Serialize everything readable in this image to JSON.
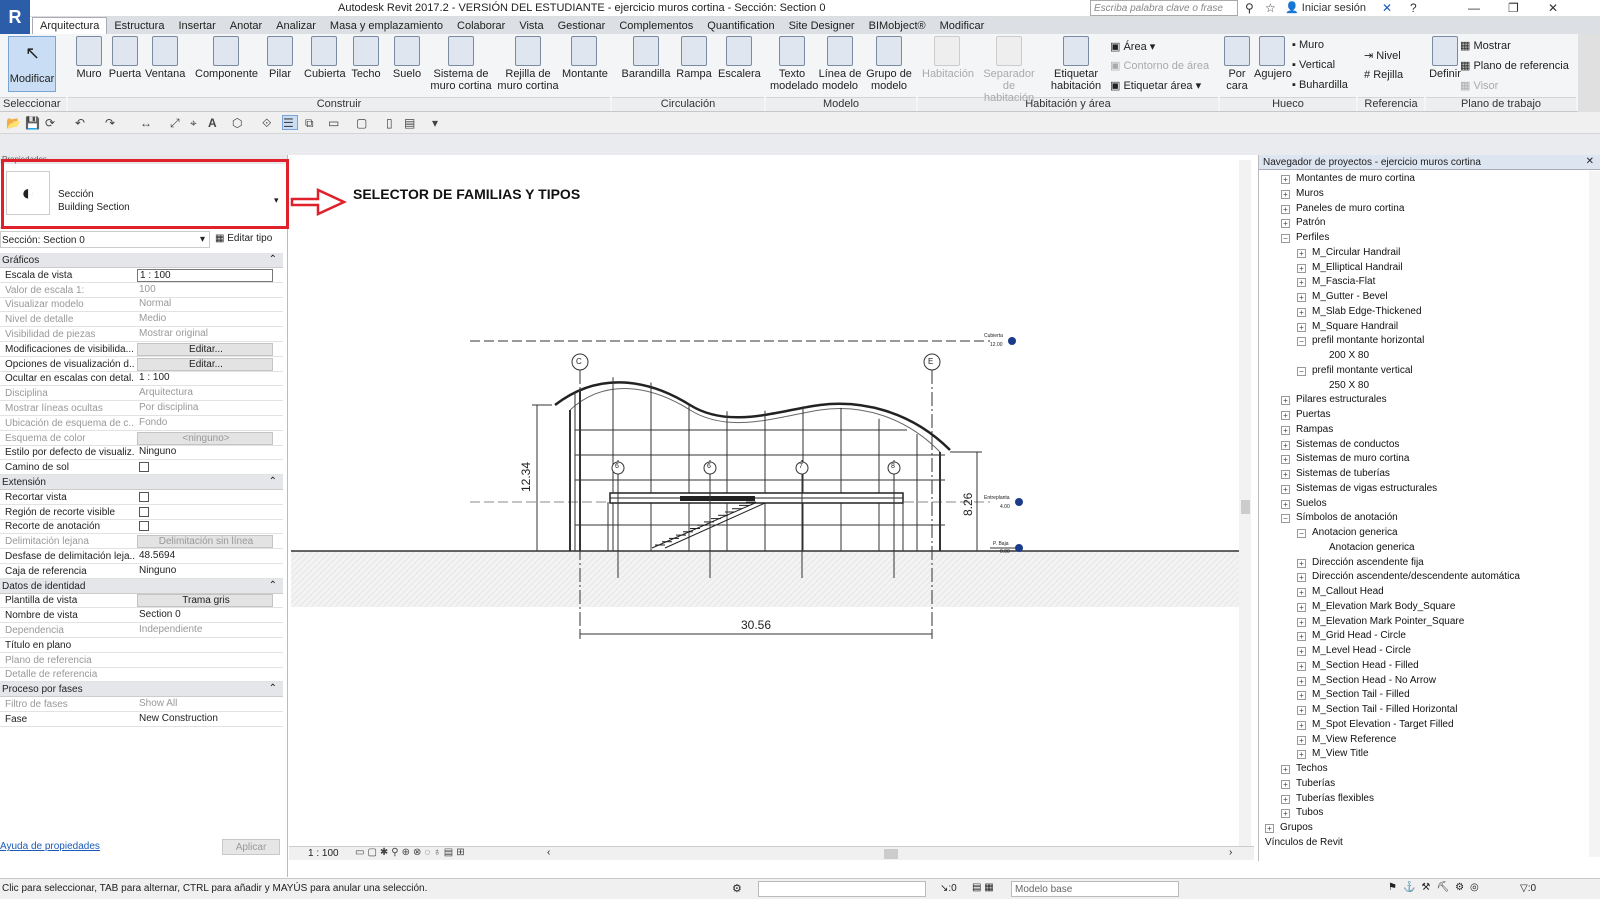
{
  "title_bar": {
    "window_title": "Autodesk Revit 2017.2 - VERSIÓN DEL ESTUDIANTE -    ejercicio muros cortina - Sección: Section 0",
    "search_placeholder": "Escriba palabra clave o frase",
    "sign_in": "Iniciar sesión"
  },
  "tabs": [
    "Arquitectura",
    "Estructura",
    "Insertar",
    "Anotar",
    "Analizar",
    "Masa y emplazamiento",
    "Colaborar",
    "Vista",
    "Gestionar",
    "Complementos",
    "Quantification",
    "Site Designer",
    "BIMobject®",
    "Modificar"
  ],
  "ribbon": {
    "modify": "Modificar",
    "select": "Seleccionar",
    "build": {
      "label": "Construir",
      "buttons": [
        "Muro",
        "Puerta",
        "Ventana",
        "Componente",
        "Pilar",
        "Cubierta",
        "Techo",
        "Suelo",
        "Sistema de muro cortina",
        "Rejilla de muro cortina",
        "Montante"
      ]
    },
    "circulation": {
      "label": "Circulación",
      "buttons": [
        "Barandilla",
        "Rampa",
        "Escalera"
      ]
    },
    "model": {
      "label": "Modelo",
      "buttons": [
        "Texto modelado",
        "Línea de modelo",
        "Grupo de modelo"
      ]
    },
    "room": {
      "label": "Habitación y área",
      "buttons": [
        "Habitación",
        "Separador de habitación",
        "Etiquetar habitación"
      ],
      "small": [
        "Área",
        "Contorno de área",
        "Etiquetar área"
      ]
    },
    "opening": {
      "label": "Hueco",
      "buttons": [
        "Por cara",
        "Agujero"
      ],
      "small": [
        "Muro",
        "Vertical",
        "Buhardilla"
      ]
    },
    "datum": {
      "label": "Referencia",
      "small": [
        "Nivel",
        "Rejilla"
      ]
    },
    "workplane": {
      "label": "Plano de trabajo",
      "buttons": [
        "Definir"
      ],
      "small": [
        "Mostrar",
        "Plano de referencia",
        "Visor"
      ]
    }
  },
  "properties": {
    "header": "Propiedades",
    "family": "Sección",
    "type": "Building Section",
    "instance": "Sección: Section 0",
    "edit_type": "Editar tipo",
    "sections": {
      "graphics": "Gráficos",
      "extents": "Extensión",
      "identity": "Datos de identidad",
      "phasing": "Proceso por fases"
    },
    "graphics_rows": [
      {
        "k": "Escala de vista",
        "v": "1 : 100"
      },
      {
        "k": "Valor de escala    1:",
        "v": "100"
      },
      {
        "k": "Visualizar modelo",
        "v": "Normal"
      },
      {
        "k": "Nivel de detalle",
        "v": "Medio"
      },
      {
        "k": "Visibilidad de piezas",
        "v": "Mostrar original"
      },
      {
        "k": "Modificaciones de visibilida...",
        "v": "Editar..."
      },
      {
        "k": "Opciones de visualización d...",
        "v": "Editar..."
      },
      {
        "k": "Ocultar en escalas con detal...",
        "v": "1 : 100"
      },
      {
        "k": "Disciplina",
        "v": "Arquitectura"
      },
      {
        "k": "Mostrar líneas ocultas",
        "v": "Por disciplina"
      },
      {
        "k": "Ubicación de esquema de c...",
        "v": "Fondo"
      },
      {
        "k": "Esquema de color",
        "v": "<ninguno>"
      },
      {
        "k": "Estilo por defecto de visualiz...",
        "v": "Ninguno"
      },
      {
        "k": "Camino de sol",
        "v": ""
      }
    ],
    "extent_rows": [
      {
        "k": "Recortar vista",
        "v": ""
      },
      {
        "k": "Región de recorte visible",
        "v": ""
      },
      {
        "k": "Recorte de anotación",
        "v": ""
      },
      {
        "k": "Delimitación lejana",
        "v": "Delimitación sin línea"
      },
      {
        "k": "Desfase de delimitación leja...",
        "v": "48.5694"
      },
      {
        "k": "Caja de referencia",
        "v": "Ninguno"
      }
    ],
    "identity_rows": [
      {
        "k": "Plantilla de vista",
        "v": "Trama gris"
      },
      {
        "k": "Nombre de vista",
        "v": "Section 0"
      },
      {
        "k": "Dependencia",
        "v": "Independiente"
      },
      {
        "k": "Título en plano",
        "v": ""
      },
      {
        "k": "Plano de referencia",
        "v": ""
      },
      {
        "k": "Detalle de referencia",
        "v": ""
      }
    ],
    "phasing_rows": [
      {
        "k": "Filtro de fases",
        "v": "Show All"
      },
      {
        "k": "Fase",
        "v": "New Construction"
      }
    ],
    "help": "Ayuda de propiedades",
    "apply": "Aplicar"
  },
  "view": {
    "callout": "SELECTOR DE FAMILIAS Y TIPOS",
    "grid_c": "C",
    "grid_e": "E",
    "marks": [
      "6",
      "6",
      "7",
      "8"
    ],
    "dim_height_left": "12.34",
    "dim_height_right": "8.26",
    "dim_width": "30.56",
    "level_top": "Cubierta",
    "level_top_value": "12.00",
    "level_mid": "Entreplanta",
    "level_mid_value": "4.00",
    "level_base": "P. Baja",
    "level_base_value": "0.00",
    "scale": "1 : 100"
  },
  "navigator": {
    "title": "Navegador de proyectos - ejercicio muros cortina",
    "items": [
      {
        "label": "Montantes de muro cortina",
        "level": 1,
        "sign": "+"
      },
      {
        "label": "Muros",
        "level": 1,
        "sign": "+"
      },
      {
        "label": "Paneles de muro cortina",
        "level": 1,
        "sign": "+"
      },
      {
        "label": "Patrón",
        "level": 1,
        "sign": "+"
      },
      {
        "label": "Perfiles",
        "level": 1,
        "sign": "−"
      },
      {
        "label": "M_Circular Handrail",
        "level": 2,
        "sign": "+"
      },
      {
        "label": "M_Elliptical Handrail",
        "level": 2,
        "sign": "+"
      },
      {
        "label": "M_Fascia-Flat",
        "level": 2,
        "sign": "+"
      },
      {
        "label": "M_Gutter - Bevel",
        "level": 2,
        "sign": "+"
      },
      {
        "label": "M_Slab Edge-Thickened",
        "level": 2,
        "sign": "+"
      },
      {
        "label": "M_Square Handrail",
        "level": 2,
        "sign": "+"
      },
      {
        "label": "prefil montante horizontal",
        "level": 2,
        "sign": "−"
      },
      {
        "label": "200 X 80",
        "level": 3,
        "sign": ""
      },
      {
        "label": "prefil montante vertical",
        "level": 2,
        "sign": "−"
      },
      {
        "label": "250 X 80",
        "level": 3,
        "sign": ""
      },
      {
        "label": "Pilares estructurales",
        "level": 1,
        "sign": "+"
      },
      {
        "label": "Puertas",
        "level": 1,
        "sign": "+"
      },
      {
        "label": "Rampas",
        "level": 1,
        "sign": "+"
      },
      {
        "label": "Sistemas de conductos",
        "level": 1,
        "sign": "+"
      },
      {
        "label": "Sistemas de muro cortina",
        "level": 1,
        "sign": "+"
      },
      {
        "label": "Sistemas de tuberías",
        "level": 1,
        "sign": "+"
      },
      {
        "label": "Sistemas de vigas estructurales",
        "level": 1,
        "sign": "+"
      },
      {
        "label": "Suelos",
        "level": 1,
        "sign": "+"
      },
      {
        "label": "Símbolos de anotación",
        "level": 1,
        "sign": "−"
      },
      {
        "label": "Anotacion generica",
        "level": 2,
        "sign": "−"
      },
      {
        "label": "Anotacion generica",
        "level": 3,
        "sign": ""
      },
      {
        "label": "Dirección ascendente fija",
        "level": 2,
        "sign": "+"
      },
      {
        "label": "Dirección ascendente/descendente automática",
        "level": 2,
        "sign": "+"
      },
      {
        "label": "M_Callout Head",
        "level": 2,
        "sign": "+"
      },
      {
        "label": "M_Elevation Mark Body_Square",
        "level": 2,
        "sign": "+"
      },
      {
        "label": "M_Elevation Mark Pointer_Square",
        "level": 2,
        "sign": "+"
      },
      {
        "label": "M_Grid Head - Circle",
        "level": 2,
        "sign": "+"
      },
      {
        "label": "M_Level Head - Circle",
        "level": 2,
        "sign": "+"
      },
      {
        "label": "M_Section Head - Filled",
        "level": 2,
        "sign": "+"
      },
      {
        "label": "M_Section Head - No Arrow",
        "level": 2,
        "sign": "+"
      },
      {
        "label": "M_Section Tail - Filled",
        "level": 2,
        "sign": "+"
      },
      {
        "label": "M_Section Tail - Filled Horizontal",
        "level": 2,
        "sign": "+"
      },
      {
        "label": "M_Spot Elevation - Target Filled",
        "level": 2,
        "sign": "+"
      },
      {
        "label": "M_View Reference",
        "level": 2,
        "sign": "+"
      },
      {
        "label": "M_View Title",
        "level": 2,
        "sign": "+"
      },
      {
        "label": "Techos",
        "level": 1,
        "sign": "+"
      },
      {
        "label": "Tuberías",
        "level": 1,
        "sign": "+"
      },
      {
        "label": "Tuberías flexibles",
        "level": 1,
        "sign": "+"
      },
      {
        "label": "Tubos",
        "level": 1,
        "sign": "+"
      },
      {
        "label": "Grupos",
        "level": 0,
        "sign": "+"
      },
      {
        "label": "Vínculos de Revit",
        "level": 0,
        "sign": ""
      }
    ]
  },
  "status": {
    "hint": "Clic para seleccionar, TAB para alternar, CTRL para añadir y MAYÚS para anular una selección.",
    "zero": ":0",
    "model": "Modelo base",
    "filter": ":0"
  },
  "colors": {
    "accent": "#2c5da8",
    "callout": "#e0202b"
  }
}
